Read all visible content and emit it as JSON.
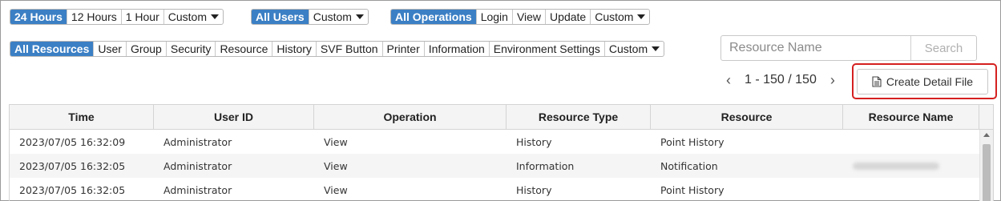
{
  "filters": {
    "time": {
      "items": [
        "24 Hours",
        "12 Hours",
        "1 Hour",
        "Custom"
      ],
      "active": 0
    },
    "users": {
      "items": [
        "All Users",
        "Custom"
      ],
      "active": 0
    },
    "operations": {
      "items": [
        "All Operations",
        "Login",
        "View",
        "Update",
        "Custom"
      ],
      "active": 0
    },
    "resources": {
      "items": [
        "All Resources",
        "User",
        "Group",
        "Security",
        "Resource",
        "History",
        "SVF Button",
        "Printer",
        "Information",
        "Environment Settings",
        "Custom"
      ],
      "active": 0
    }
  },
  "search": {
    "placeholder": "Resource Name",
    "button": "Search"
  },
  "pager": {
    "range": "1 - 150 / 150",
    "prev_icon": "chevron-left-icon",
    "next_icon": "chevron-right-icon"
  },
  "detail_button": {
    "label": "Create Detail File",
    "icon": "document-icon"
  },
  "colors": {
    "accent": "#3b7fc4",
    "highlight": "#d52020"
  },
  "table": {
    "columns": [
      "Time",
      "User ID",
      "Operation",
      "Resource Type",
      "Resource",
      "Resource Name"
    ],
    "rows": [
      [
        "2023/07/05 16:32:09",
        "Administrator",
        "View",
        "History",
        "Point History",
        ""
      ],
      [
        "2023/07/05 16:32:05",
        "Administrator",
        "View",
        "Information",
        "Notification",
        ""
      ],
      [
        "2023/07/05 16:32:05",
        "Administrator",
        "View",
        "History",
        "Point History",
        ""
      ]
    ]
  }
}
